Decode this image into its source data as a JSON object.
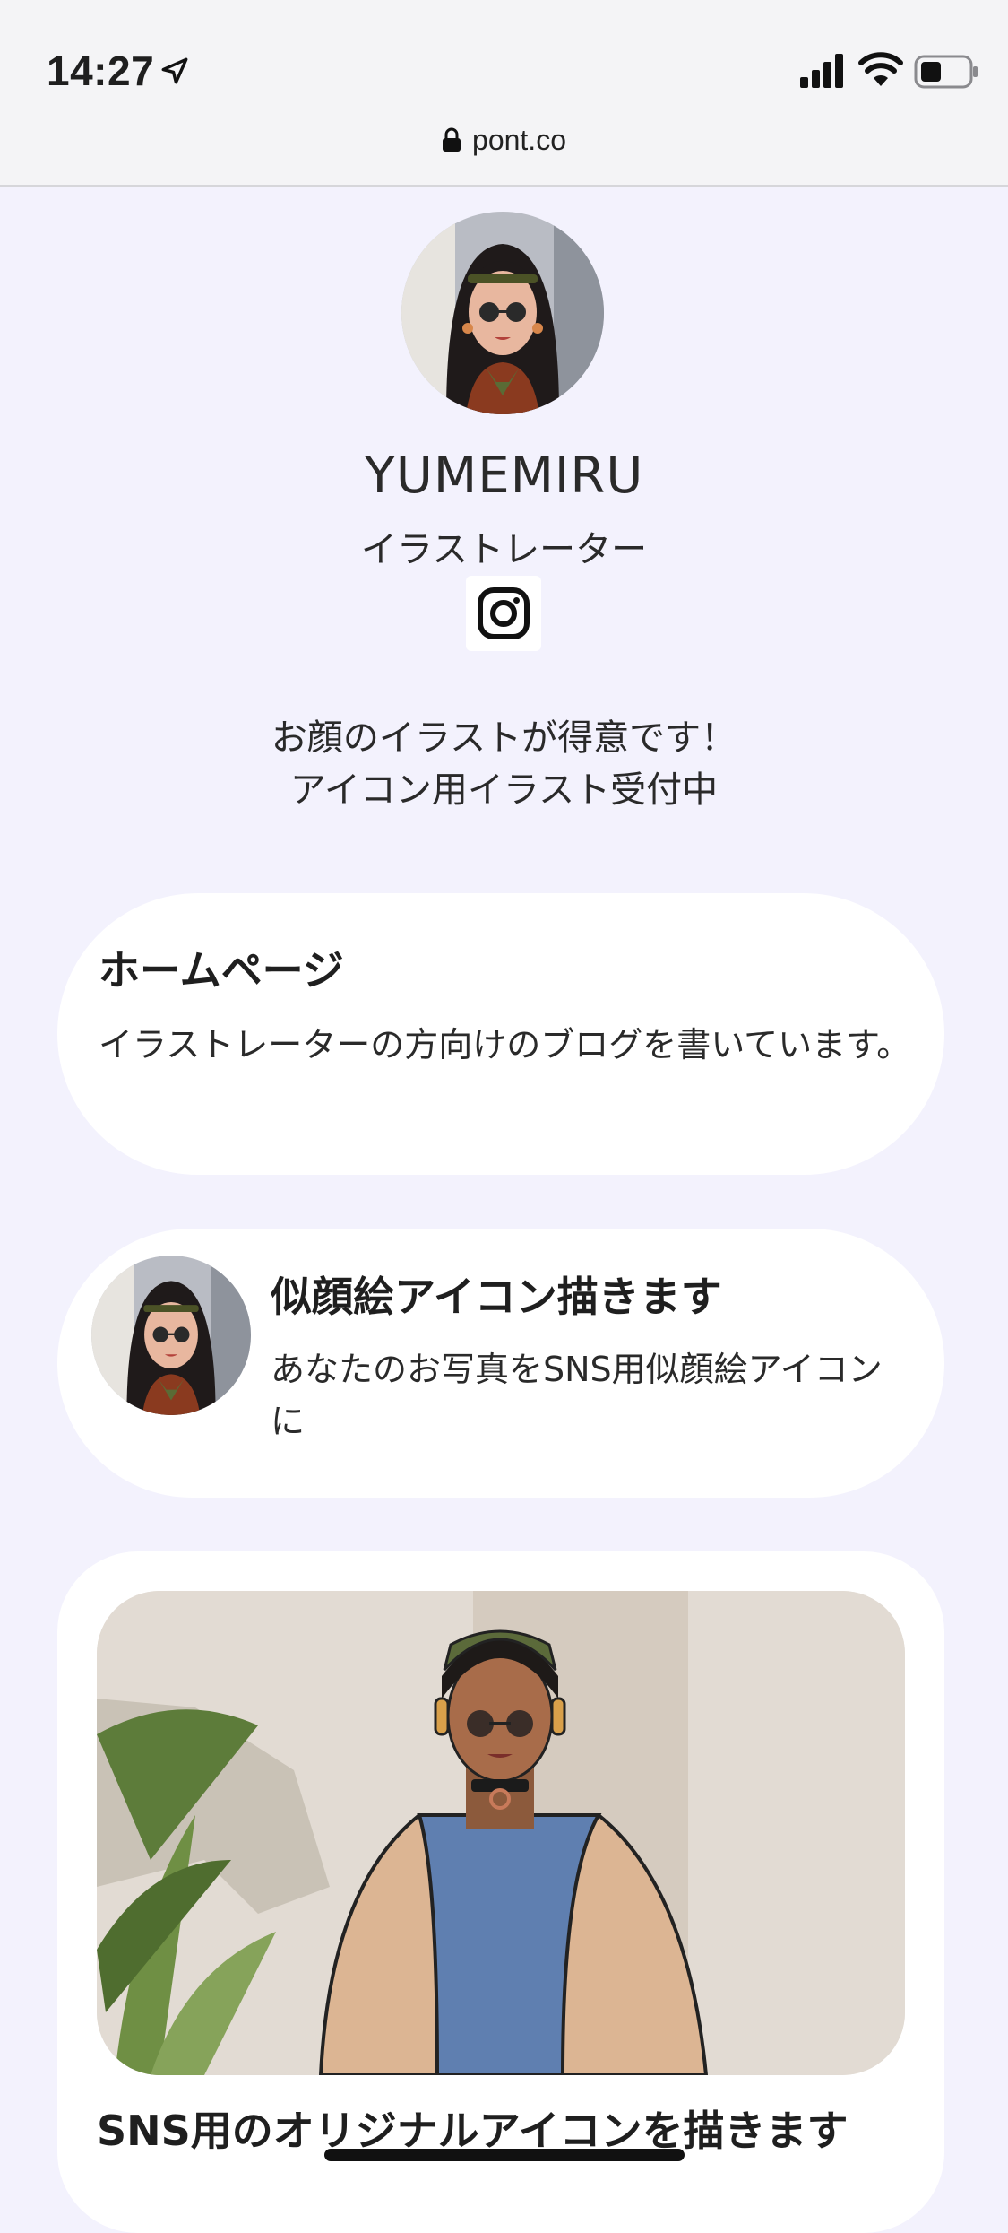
{
  "status_bar": {
    "time": "14:27",
    "icons": [
      "location-arrow-icon",
      "cellular-signal-icon",
      "wifi-icon",
      "battery-icon"
    ]
  },
  "browser": {
    "url": "pont.co"
  },
  "profile": {
    "name": "YUMEMIRU",
    "role": "イラストレーター",
    "social_icon": "instagram-icon",
    "bio_line1": "お顔のイラストが得意です！",
    "bio_line2": "アイコン用イラスト受付中"
  },
  "links": [
    {
      "title": "ホームページ",
      "description": "イラストレーターの方向けのブログを書いています。"
    },
    {
      "title": "似顔絵アイコン描きます",
      "description": "あなたのお写真をSNS用似顔絵アイコンに"
    },
    {
      "title": "SNS用のオリジナルアイコンを描きます"
    }
  ],
  "colors": {
    "page_background": "#f3f2fd",
    "card_background": "#ffffff",
    "text": "#1f1f1f"
  }
}
